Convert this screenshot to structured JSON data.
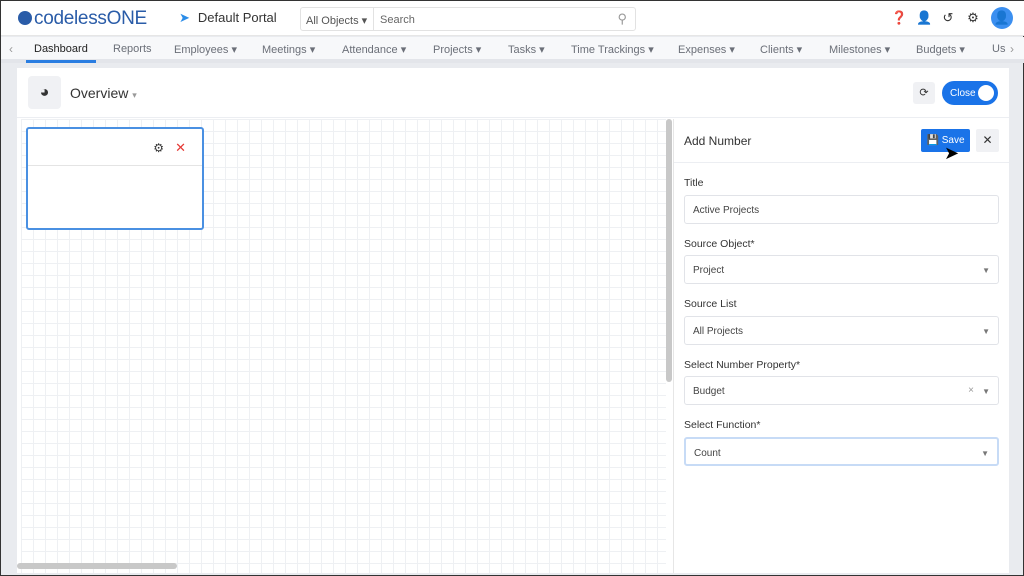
{
  "header": {
    "logo": "codelessONE",
    "portal": "Default Portal",
    "search_scope": "All Objects",
    "search_placeholder": "Search"
  },
  "nav": {
    "items": [
      "Dashboard",
      "Reports",
      "Employees",
      "Meetings",
      "Attendance",
      "Projects",
      "Tasks",
      "Time Trackings",
      "Expenses",
      "Clients",
      "Milestones",
      "Budgets",
      "Us"
    ],
    "active": "Dashboard"
  },
  "dashboard": {
    "title": "Overview",
    "toggle_label": "Close"
  },
  "panel": {
    "title": "Add Number",
    "save_label": "Save",
    "fields": [
      {
        "label": "Title",
        "value": "Active Projects"
      },
      {
        "label": "Source Object*",
        "value": "Project"
      },
      {
        "label": "Source List",
        "value": "All Projects"
      },
      {
        "label": "Select Number Property*",
        "value": "Budget"
      },
      {
        "label": "Select Function*",
        "value": "Count"
      }
    ]
  },
  "colors": {
    "accent": "#1a73e8"
  }
}
